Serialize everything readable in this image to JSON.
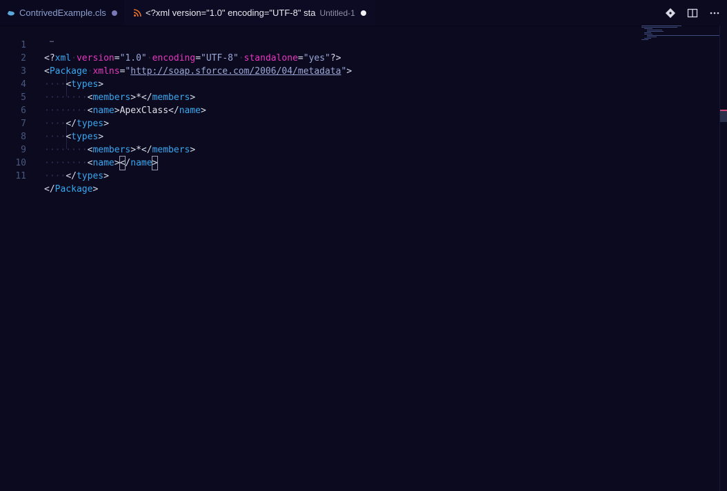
{
  "tabs": [
    {
      "filename": "ContrivedExample.cls",
      "icon": "salesforce-cloud-icon",
      "dirty": true,
      "active": false
    },
    {
      "title": "<?xml version=\"1.0\" encoding=\"UTF-8\" sta",
      "description": "Untitled-1",
      "icon": "xml-rss-icon",
      "dirty": true,
      "active": true
    }
  ],
  "actions": [
    {
      "name": "source-control-icon",
      "glyph": "◆"
    },
    {
      "name": "split-editor-icon",
      "glyph": "◫"
    },
    {
      "name": "more-actions-icon",
      "glyph": "⋯"
    }
  ],
  "line_numbers": [
    "1",
    "2",
    "3",
    "4",
    "5",
    "6",
    "7",
    "8",
    "9",
    "10",
    "11"
  ],
  "code": {
    "l1": {
      "open": "<?",
      "tag": "xml",
      "a1": "version",
      "v1": "\"1.0\"",
      "a2": "encoding",
      "v2": "\"UTF-8\"",
      "a3": "standalone",
      "v3": "\"yes\"",
      "close": "?>"
    },
    "l2": {
      "open": "<",
      "tag": "Package",
      "attr": "xmlns",
      "eq": "=",
      "q1": "\"",
      "url": "http://soap.sforce.com/2006/04/metadata",
      "q2": "\"",
      "close": ">"
    },
    "l3": {
      "tag": "types"
    },
    "l4": {
      "tag": "members",
      "text": "*"
    },
    "l5": {
      "tag": "name",
      "text": "ApexClass"
    },
    "l6": {
      "tag": "types"
    },
    "l7": {
      "tag": "types"
    },
    "l8": {
      "tag": "members",
      "text": "*"
    },
    "l9": {
      "tag": "name",
      "text": "<"
    },
    "l10": {
      "tag": "types"
    },
    "l11": {
      "tag": "Package"
    }
  },
  "colors": {
    "background": "#0c0a1f",
    "tag": "#39a8f0",
    "attribute": "#e637bf",
    "string": "#9aa7d6",
    "line_number": "#49587e"
  }
}
